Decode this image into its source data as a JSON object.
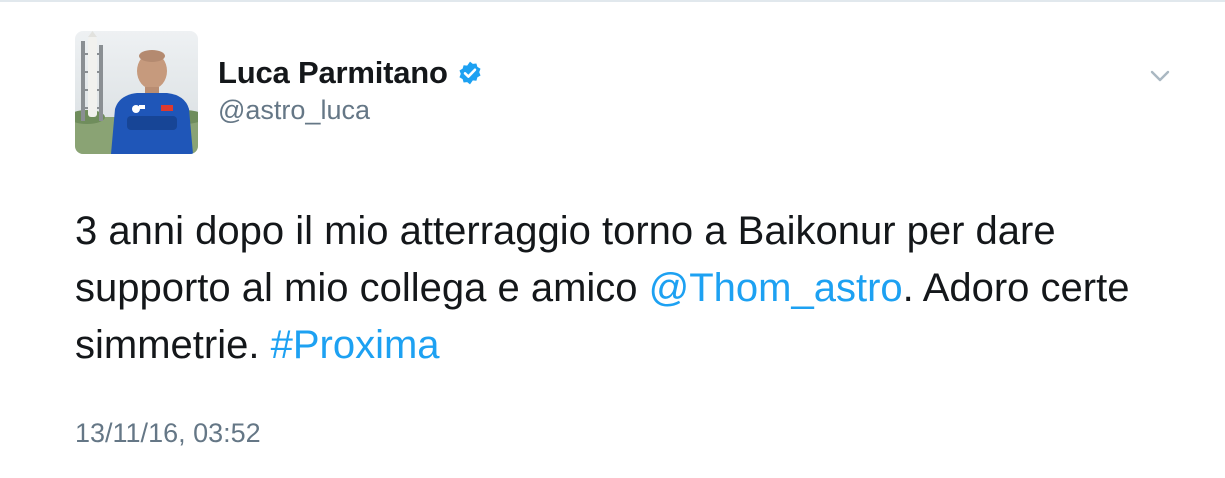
{
  "tweet": {
    "author": {
      "display_name": "Luca Parmitano",
      "handle": "@astro_luca",
      "verified": true,
      "avatar_icon": "astronaut-portrait"
    },
    "text": {
      "part1": "3 anni dopo il mio atterraggio torno a Baikonur per dare supporto al mio collega e amico ",
      "mention": "@Thom_astro",
      "part2": ". Adoro certe simmetrie. ",
      "hashtag": "#Proxima"
    },
    "timestamp": "13/11/16, 03:52",
    "menu_icon": "chevron-down-icon"
  },
  "colors": {
    "text": "#14171a",
    "secondary": "#657786",
    "link": "#1da1f2",
    "verified": "#1da1f2",
    "divider": "#e1e8ed"
  }
}
